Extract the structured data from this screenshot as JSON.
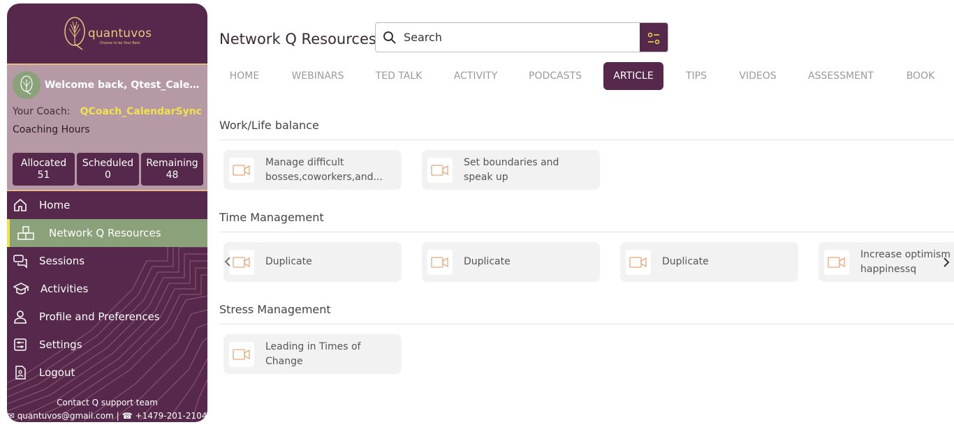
{
  "app": {
    "logo_name": "quantuvos",
    "logo_tagline": "Choose to be Your Best"
  },
  "sidebar": {
    "welcome": "Welcome back, Qtest_CalendarSync",
    "coach_label": "Your Coach:",
    "coach_name": "QCoach_CalendarSync",
    "hours_title": "Coaching Hours",
    "hours": [
      {
        "label": "Allocated",
        "value": "51"
      },
      {
        "label": "Scheduled",
        "value": "0"
      },
      {
        "label": "Remaining",
        "value": "48"
      }
    ],
    "nav": [
      {
        "label": "Home",
        "icon": "home-icon"
      },
      {
        "label": "Network Q Resources",
        "icon": "resources-icon",
        "active": true
      },
      {
        "label": "Sessions",
        "icon": "chat-icon"
      },
      {
        "label": "Activities",
        "icon": "graduation-cap-icon"
      },
      {
        "label": "Profile and Preferences",
        "icon": "user-icon"
      },
      {
        "label": "Settings",
        "icon": "settings-icon"
      },
      {
        "label": "Logout",
        "icon": "logout-icon"
      }
    ],
    "contact_title": "Contact Q support team",
    "contact_email": "quantuvos@gmail.com",
    "contact_phone": "+1479-201-2104"
  },
  "main": {
    "title": "Network Q Resources",
    "search_placeholder": "Search",
    "tabs": [
      "HOME",
      "WEBINARS",
      "TED TALK",
      "ACTIVITY",
      "PODCASTS",
      "ARTICLE",
      "TIPS",
      "VIDEOS",
      "ASSESSMENT",
      "BOOK"
    ],
    "active_tab": "ARTICLE",
    "sections": [
      {
        "title": "Work/Life balance",
        "items": [
          "Manage difficult bosses,coworkers,and...",
          "Set boundaries and speak up"
        ]
      },
      {
        "title": "Time Management",
        "items": [
          "Duplicate",
          "Duplicate",
          "Duplicate",
          "Increase optimism happinessq"
        ]
      },
      {
        "title": "Stress Management",
        "items": [
          "Leading in Times of Change"
        ]
      }
    ]
  },
  "colors": {
    "brand": "#56294c",
    "accent_green": "#8aa17a",
    "accent_yellow": "#f0e24a",
    "video_icon": "#e8a77a"
  }
}
